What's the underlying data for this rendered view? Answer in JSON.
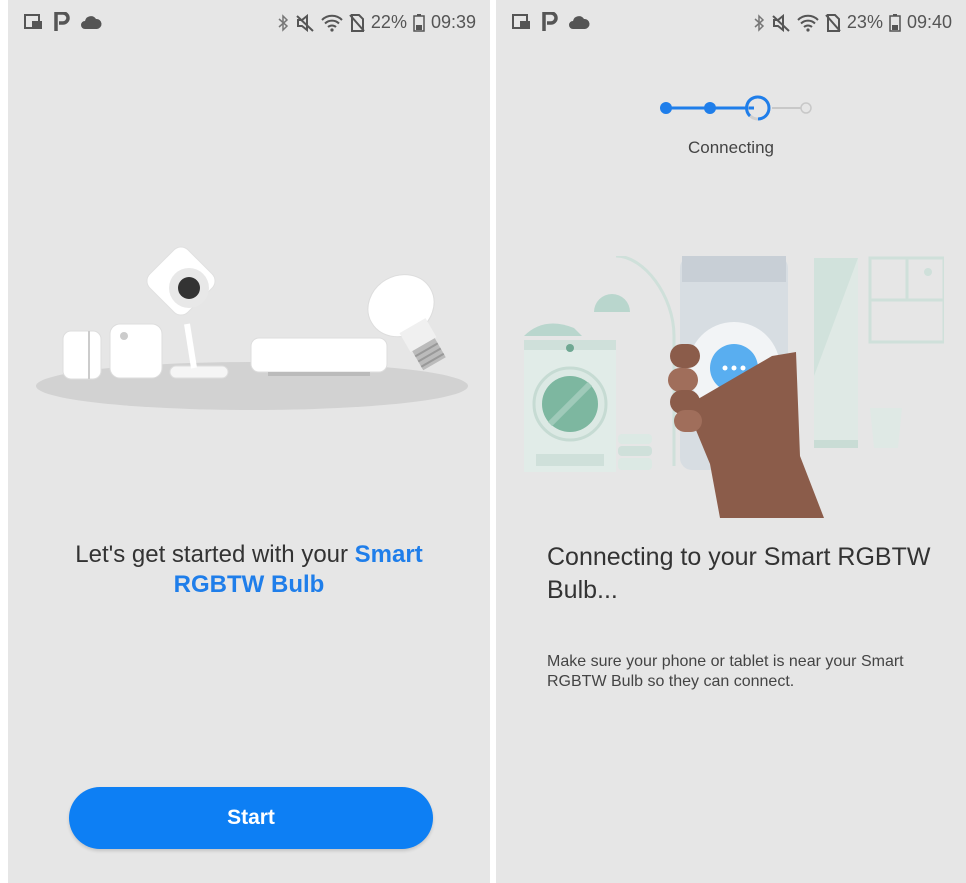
{
  "colors": {
    "accent": "#1f7eea",
    "button": "#0d7ff4",
    "background": "#e6e6e6"
  },
  "left_screen": {
    "status_bar": {
      "icons_left": [
        "video-call-icon",
        "parking-icon",
        "cloud-icon"
      ],
      "icons_right": [
        "bluetooth-icon",
        "mute-icon",
        "wifi-icon",
        "no-sim-icon",
        "battery-icon"
      ],
      "battery": "22%",
      "time": "09:39"
    },
    "headline_prefix": "Let's get started with your ",
    "headline_accent": "Smart RGBTW Bulb",
    "start_button": "Start"
  },
  "right_screen": {
    "status_bar": {
      "icons_left": [
        "video-call-icon",
        "parking-icon",
        "cloud-icon"
      ],
      "icons_right": [
        "bluetooth-icon",
        "mute-icon",
        "wifi-icon",
        "no-sim-icon",
        "battery-icon"
      ],
      "battery": "23%",
      "time": "09:40"
    },
    "stepper": {
      "label": "Connecting",
      "steps_done": 2,
      "current_step": 3,
      "steps_total": 4
    },
    "headline": "Connecting to your Smart RGBTW Bulb...",
    "body": "Make sure your phone or tablet is near your Smart RGBTW Bulb so they can connect."
  }
}
